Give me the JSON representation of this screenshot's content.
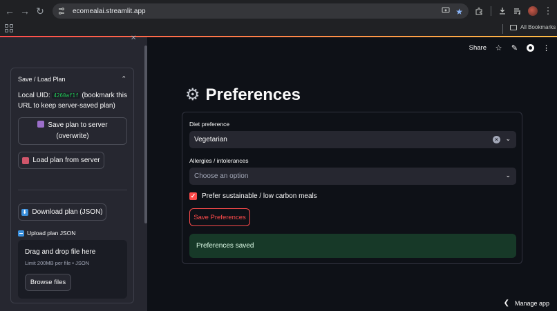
{
  "browser": {
    "url": "ecomealai.streamlit.app",
    "all_bookmarks": "All Bookmarks"
  },
  "sidebar": {
    "expander": {
      "title": "Save / Load Plan",
      "uid_label": "Local UID:",
      "uid_value": "4260af1f",
      "uid_hint": "(bookmark this URL to keep server-saved plan)",
      "save_line1": "Save plan to server",
      "save_line2": "(overwrite)",
      "load_label": "Load plan from server",
      "download_label": "Download plan (JSON)",
      "upload_label": "Upload plan JSON",
      "dropzone_title": "Drag and drop file here",
      "dropzone_limit": "Limit 200MB per file • JSON",
      "browse_label": "Browse files"
    }
  },
  "toolbar": {
    "share_label": "Share"
  },
  "main": {
    "title": "Preferences",
    "diet_label": "Diet preference",
    "diet_value": "Vegetarian",
    "allergies_label": "Allergies / intolerances",
    "allergies_placeholder": "Choose an option",
    "sustainable_label": "Prefer sustainable / low carbon meals",
    "sustainable_checked": true,
    "save_button": "Save Preferences",
    "success_message": "Preferences saved"
  },
  "footer": {
    "manage_app": "Manage app"
  },
  "colors": {
    "accent": "#ff4b4b",
    "success_bg": "#173928",
    "sidebar_bg": "#262730",
    "main_bg": "#0e1117"
  },
  "icons": [
    "back-arrow-icon",
    "forward-arrow-icon",
    "reload-icon",
    "site-settings-icon",
    "install-app-icon",
    "star-icon",
    "extensions-icon",
    "download-icon",
    "media-icon",
    "profile-avatar",
    "menu-icon",
    "apps-icon",
    "folder-icon",
    "close-icon",
    "chevron-up-icon",
    "floppy-disk-icon",
    "card-box-icon",
    "download-arrow-icon",
    "upload-icon",
    "pencil-icon",
    "github-icon",
    "gear-icon",
    "clear-icon",
    "chevron-down-icon",
    "checkbox-checked-icon",
    "chevron-left-icon"
  ]
}
